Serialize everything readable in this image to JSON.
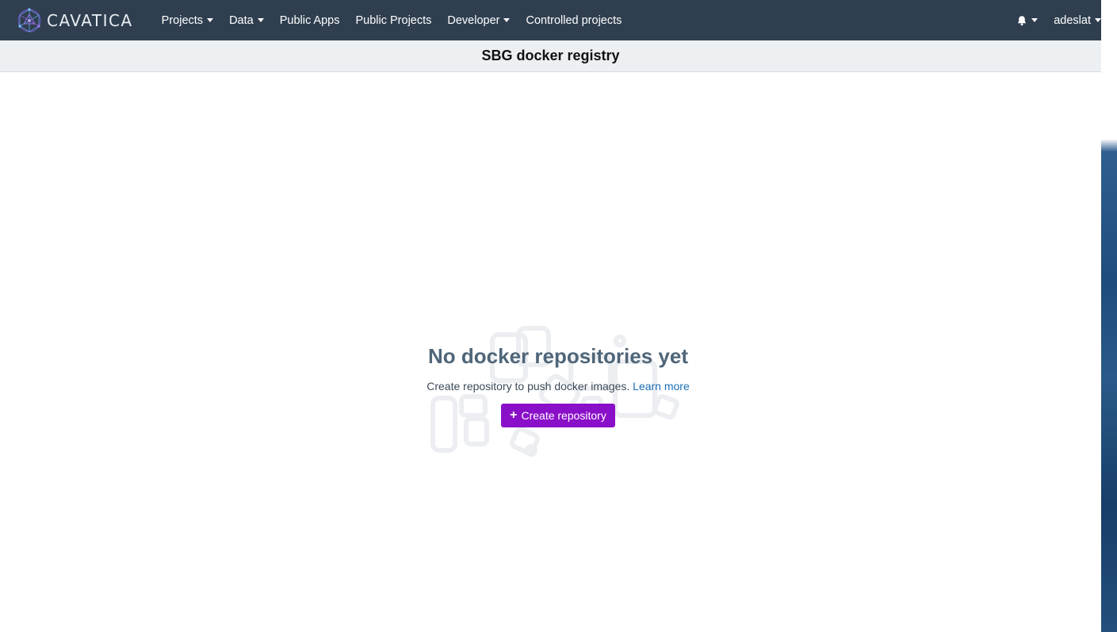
{
  "brand": {
    "name": "CAVATICA",
    "logo_icon": "cavatica-logo-icon"
  },
  "nav": {
    "items": [
      {
        "label": "Projects",
        "dropdown": true
      },
      {
        "label": "Data",
        "dropdown": true
      },
      {
        "label": "Public Apps",
        "dropdown": false
      },
      {
        "label": "Public Projects",
        "dropdown": false
      },
      {
        "label": "Developer",
        "dropdown": true
      },
      {
        "label": "Controlled projects",
        "dropdown": false
      }
    ],
    "notifications_icon": "bell-icon",
    "user": "adeslat"
  },
  "page": {
    "title": "SBG docker registry"
  },
  "empty_state": {
    "title": "No docker repositories yet",
    "description": "Create repository to push docker images.",
    "learn_more": "Learn more",
    "button_label": "Create repository",
    "button_icon": "plus-icon"
  },
  "colors": {
    "navbar": "#2f3f50",
    "subheader": "#ecf0f2",
    "accent_button": "#8a0fc8",
    "link": "#1a6fb5",
    "empty_title": "#4f6579"
  }
}
